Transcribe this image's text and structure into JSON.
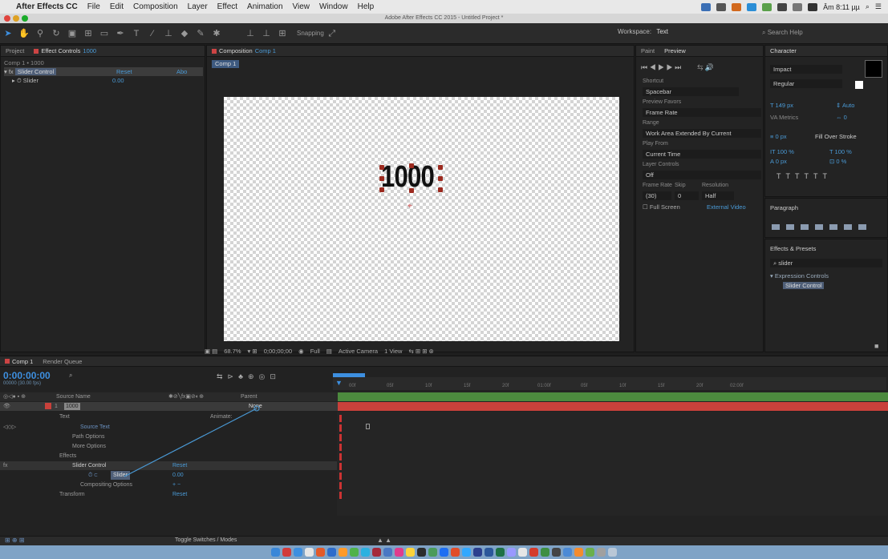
{
  "menubar": {
    "app_name": "After Effects CC",
    "items": [
      "File",
      "Edit",
      "Composition",
      "Layer",
      "Effect",
      "Animation",
      "View",
      "Window",
      "Help"
    ],
    "clock": "Âm 8:11 µµ"
  },
  "window": {
    "title": "Adobe After Effects CC 2015 - Untitled Project *"
  },
  "toolbar": {
    "snapping": "Snapping",
    "workspace_label": "Workspace:",
    "workspace_value": "Text",
    "search_placeholder": "Search Help"
  },
  "project_panel": {
    "tab_project": "Project",
    "tab_effect_controls": "Effect Controls",
    "effect_layer": "1000",
    "subtitle": "Comp 1 • 1000",
    "effect_name": "Slider Control",
    "reset_label": "Reset",
    "about_label": "Abo",
    "slider_label": "Slider",
    "slider_value": "0.00"
  },
  "composition_panel": {
    "tab_label": "Composition",
    "comp_name": "Comp 1",
    "comp_tab": "Comp 1",
    "canvas_text": "1000",
    "zoom": "68.7%",
    "timecode": "0;00;00;00",
    "resolution": "Full",
    "camera": "Active Camera",
    "views": "1 View"
  },
  "preview_panel": {
    "tab_paint": "Paint",
    "tab_preview": "Preview",
    "shortcut_label": "Shortcut",
    "shortcut_value": "Spacebar",
    "preview_favors_label": "Preview Favors",
    "preview_favors_value": "Frame Rate",
    "range_label": "Range",
    "range_value": "Work Area Extended By Current",
    "play_from_label": "Play From",
    "play_from_value": "Current Time",
    "layer_controls_label": "Layer Controls",
    "layer_controls_value": "Off",
    "frame_rate_label": "Frame Rate",
    "skip_label": "Skip",
    "resolution_label": "Resolution",
    "frame_rate_value": "(30)",
    "skip_value": "0",
    "resolution_value": "Half",
    "full_screen": "Full Screen",
    "external_video": "External Video"
  },
  "character_panel": {
    "tab_label": "Character",
    "font": "Impact",
    "style": "Regular",
    "size": "149 px",
    "leading": "Auto",
    "kerning": "Metrics",
    "tracking": "0",
    "stroke_width": "0 px",
    "stroke_type": "Fill Over Stroke",
    "vscale": "100 %",
    "hscale": "100 %",
    "baseline": "0 px",
    "tsume": "0 %",
    "paragraph_tab": "Paragraph"
  },
  "effects_presets": {
    "tab_label": "Effects & Presets",
    "search_value": "slider",
    "category": "Expression Controls",
    "result": "Slider Control"
  },
  "timeline": {
    "tab_comp": "Comp 1",
    "tab_render": "Render Queue",
    "timecode": "0:00:00:00",
    "fps": "00000 (30.00 fps)",
    "source_name_header": "Source Name",
    "parent_header": "Parent",
    "layer_number": "1",
    "layer_name": "1000",
    "parent_value": "None",
    "rows": {
      "text": "Text",
      "animate": "Animate:",
      "source_text": "Source Text",
      "path_options": "Path Options",
      "more_options": "More Options",
      "effects": "Effects",
      "slider_control": "Slider Control",
      "reset1": "Reset",
      "slider": "Slider",
      "slider_value": "0.00",
      "compositing": "Compositing Options",
      "compositing_value": "+ −",
      "transform": "Transform",
      "reset2": "Reset"
    },
    "ruler_ticks": [
      "00f",
      "05f",
      "10f",
      "15f",
      "20f",
      "01:00f",
      "05f",
      "10f",
      "15f",
      "20f",
      "02:00f"
    ],
    "toggle_label": "Toggle Switches / Modes"
  },
  "colors": {
    "accent_blue": "#4a9ad6",
    "layer_red": "#c9413b",
    "track_green": "#4c8a3e",
    "canvas_text": "#111111"
  }
}
